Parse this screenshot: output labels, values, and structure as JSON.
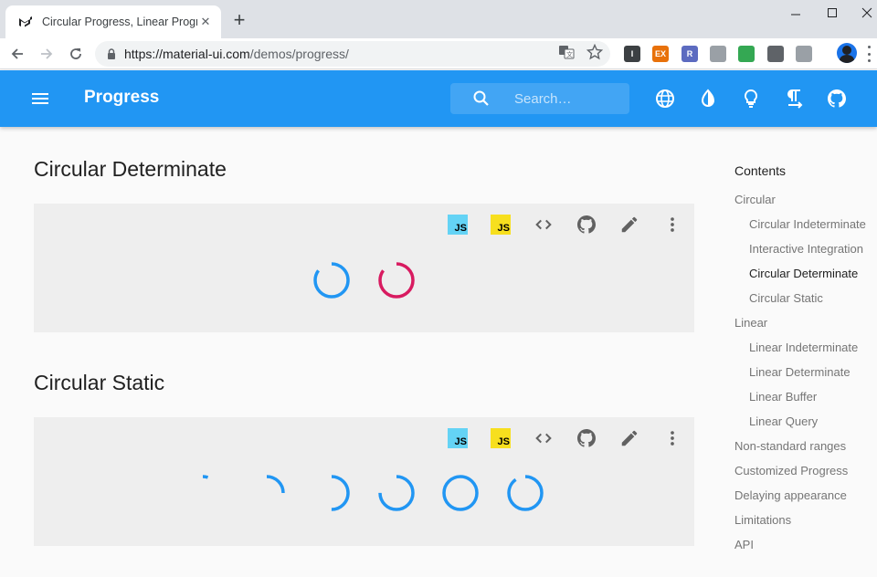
{
  "browser": {
    "tab_title": "Circular Progress, Linear Progre",
    "url_host": "https://material-ui.com",
    "url_path": "/demos/progress/",
    "extensions": [
      {
        "name": "bookmark-ext-icon",
        "color": "#3c4043",
        "label": "I"
      },
      {
        "name": "ex-ext-icon",
        "color": "#e8710a",
        "label": "EX"
      },
      {
        "name": "r-ext-icon",
        "color": "#5c6bc0",
        "label": "R"
      },
      {
        "name": "download-ext-icon",
        "color": "#9aa0a6",
        "label": ""
      },
      {
        "name": "green-ext-icon",
        "color": "#34a853",
        "label": ""
      },
      {
        "name": "infinity-ext-icon",
        "color": "#5f6368",
        "label": ""
      },
      {
        "name": "download2-ext-icon",
        "color": "#9aa0a6",
        "label": ""
      }
    ]
  },
  "appbar": {
    "title": "Progress",
    "search_placeholder": "Search…",
    "color": "#2196f3"
  },
  "sections": [
    {
      "title": "Circular Determinate"
    },
    {
      "title": "Circular Static"
    }
  ],
  "demo_toolbar": {
    "js_badge": "JS",
    "js_colors": [
      "#64d3f5",
      "#f7df1e"
    ]
  },
  "determinate_progress": [
    {
      "color": "#2196f3",
      "value": 85
    },
    {
      "color": "#d81b60",
      "value": 85
    }
  ],
  "static_progress": [
    {
      "value": 5
    },
    {
      "value": 25
    },
    {
      "value": 50
    },
    {
      "value": 75
    },
    {
      "value": 100
    },
    {
      "value": 90
    }
  ],
  "toc": {
    "title": "Contents",
    "items": [
      {
        "label": "Circular",
        "level": 1,
        "active": false
      },
      {
        "label": "Circular Indeterminate",
        "level": 2,
        "active": false
      },
      {
        "label": "Interactive Integration",
        "level": 2,
        "active": false
      },
      {
        "label": "Circular Determinate",
        "level": 2,
        "active": true
      },
      {
        "label": "Circular Static",
        "level": 2,
        "active": false
      },
      {
        "label": "Linear",
        "level": 1,
        "active": false
      },
      {
        "label": "Linear Indeterminate",
        "level": 2,
        "active": false
      },
      {
        "label": "Linear Determinate",
        "level": 2,
        "active": false
      },
      {
        "label": "Linear Buffer",
        "level": 2,
        "active": false
      },
      {
        "label": "Linear Query",
        "level": 2,
        "active": false
      },
      {
        "label": "Non-standard ranges",
        "level": 1,
        "active": false
      },
      {
        "label": "Customized Progress",
        "level": 1,
        "active": false
      },
      {
        "label": "Delaying appearance",
        "level": 1,
        "active": false
      },
      {
        "label": "Limitations",
        "level": 1,
        "active": false
      },
      {
        "label": "API",
        "level": 1,
        "active": false
      }
    ]
  }
}
